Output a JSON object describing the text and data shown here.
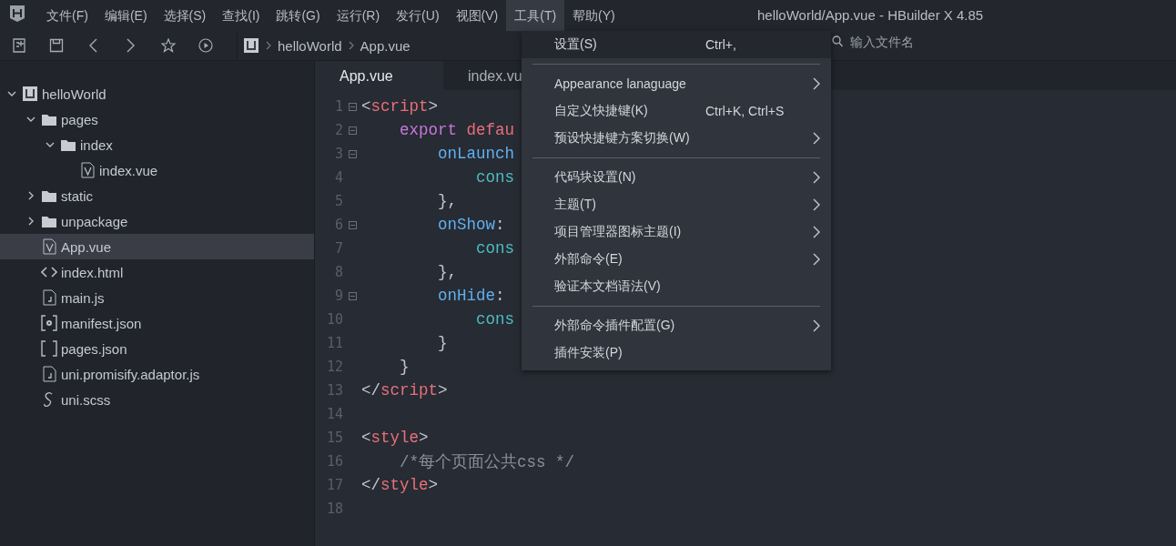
{
  "window": {
    "title": "helloWorld/App.vue - HBuilder X 4.85"
  },
  "menu_bar": [
    {
      "label": "文件(F)",
      "selected": false
    },
    {
      "label": "编辑(E)",
      "selected": false
    },
    {
      "label": "选择(S)",
      "selected": false
    },
    {
      "label": "查找(I)",
      "selected": false
    },
    {
      "label": "跳转(G)",
      "selected": false
    },
    {
      "label": "运行(R)",
      "selected": false
    },
    {
      "label": "发行(U)",
      "selected": false
    },
    {
      "label": "视图(V)",
      "selected": false
    },
    {
      "label": "工具(T)",
      "selected": true
    },
    {
      "label": "帮助(Y)",
      "selected": false
    }
  ],
  "breadcrumb": [
    "helloWorld",
    "App.vue"
  ],
  "search": {
    "placeholder": "输入文件名"
  },
  "project_tree": [
    {
      "label": "helloWorld",
      "kind": "project",
      "expanded": true,
      "selected": false,
      "children": [
        {
          "label": "pages",
          "kind": "folder",
          "expanded": true,
          "selected": false,
          "children": [
            {
              "label": "index",
              "kind": "folder",
              "expanded": true,
              "selected": false,
              "children": [
                {
                  "label": "index.vue",
                  "kind": "vue",
                  "selected": false
                }
              ]
            }
          ]
        },
        {
          "label": "static",
          "kind": "folder",
          "expanded": false,
          "selected": false
        },
        {
          "label": "unpackage",
          "kind": "folder",
          "expanded": false,
          "selected": false
        },
        {
          "label": "App.vue",
          "kind": "vue",
          "selected": true
        },
        {
          "label": "index.html",
          "kind": "html",
          "selected": false
        },
        {
          "label": "main.js",
          "kind": "js",
          "selected": false
        },
        {
          "label": "manifest.json",
          "kind": "settings",
          "selected": false
        },
        {
          "label": "pages.json",
          "kind": "brackets",
          "selected": false
        },
        {
          "label": "uni.promisify.adaptor.js",
          "kind": "js",
          "selected": false
        },
        {
          "label": "uni.scss",
          "kind": "scss",
          "selected": false
        }
      ]
    }
  ],
  "editor_tabs": [
    {
      "label": "App.vue",
      "selected": true
    },
    {
      "label": "index.vu",
      "selected": false
    }
  ],
  "code_lines": [
    {
      "number": "1",
      "fold": true,
      "tokens": [
        {
          "kind": "punct",
          "text": "<"
        },
        {
          "kind": "tag",
          "text": "script"
        },
        {
          "kind": "punct",
          "text": ">"
        }
      ]
    },
    {
      "number": "2",
      "fold": true,
      "tokens": [
        {
          "kind": "keyword",
          "text": "    export "
        },
        {
          "kind": "tag",
          "text": "defau"
        }
      ]
    },
    {
      "number": "3",
      "fold": true,
      "tokens": [
        {
          "kind": "prop",
          "text": "        onLaunch"
        }
      ]
    },
    {
      "number": "4",
      "fold": false,
      "tokens": [
        {
          "kind": "call",
          "text": "            cons"
        }
      ]
    },
    {
      "number": "5",
      "fold": false,
      "tokens": [
        {
          "kind": "punct",
          "text": "        },"
        }
      ]
    },
    {
      "number": "6",
      "fold": true,
      "tokens": [
        {
          "kind": "prop",
          "text": "        onShow"
        },
        {
          "kind": "punct",
          "text": ":"
        }
      ]
    },
    {
      "number": "7",
      "fold": false,
      "tokens": [
        {
          "kind": "call",
          "text": "            cons"
        }
      ]
    },
    {
      "number": "8",
      "fold": false,
      "tokens": [
        {
          "kind": "punct",
          "text": "        },"
        }
      ]
    },
    {
      "number": "9",
      "fold": true,
      "tokens": [
        {
          "kind": "prop",
          "text": "        onHide"
        },
        {
          "kind": "punct",
          "text": ":"
        }
      ]
    },
    {
      "number": "10",
      "fold": false,
      "tokens": [
        {
          "kind": "call",
          "text": "            cons"
        }
      ]
    },
    {
      "number": "11",
      "fold": false,
      "tokens": [
        {
          "kind": "punct",
          "text": "        }"
        }
      ]
    },
    {
      "number": "12",
      "fold": false,
      "tokens": [
        {
          "kind": "punct",
          "text": "    }"
        }
      ]
    },
    {
      "number": "13",
      "fold": false,
      "tokens": [
        {
          "kind": "punct",
          "text": "</"
        },
        {
          "kind": "tag",
          "text": "script"
        },
        {
          "kind": "punct",
          "text": ">"
        }
      ]
    },
    {
      "number": "14",
      "fold": false
    },
    {
      "number": "15",
      "fold": false,
      "tokens": [
        {
          "kind": "punct",
          "text": "<"
        },
        {
          "kind": "tag",
          "text": "style"
        },
        {
          "kind": "punct",
          "text": ">"
        }
      ]
    },
    {
      "number": "16",
      "fold": false,
      "tokens": [
        {
          "kind": "comment",
          "text": "    /*每个页面公共css */"
        }
      ]
    },
    {
      "number": "17",
      "fold": false,
      "tokens": [
        {
          "kind": "punct",
          "text": "</"
        },
        {
          "kind": "tag",
          "text": "style"
        },
        {
          "kind": "punct",
          "text": ">"
        }
      ]
    },
    {
      "number": "18",
      "fold": false
    }
  ],
  "tools_menu": [
    {
      "kind": "item",
      "label": "设置(S)",
      "shortcut": "Ctrl+,",
      "submenu": false,
      "selected": true
    },
    {
      "kind": "separator"
    },
    {
      "kind": "item",
      "label": "Appearance lanaguage",
      "submenu": true,
      "selected": false
    },
    {
      "kind": "item",
      "label": "自定义快捷键(K)",
      "shortcut": "Ctrl+K, Ctrl+S",
      "submenu": false,
      "selected": false
    },
    {
      "kind": "item",
      "label": "预设快捷键方案切换(W)",
      "submenu": true,
      "selected": false
    },
    {
      "kind": "separator"
    },
    {
      "kind": "item",
      "label": "代码块设置(N)",
      "submenu": true,
      "selected": false
    },
    {
      "kind": "item",
      "label": "主题(T)",
      "submenu": true,
      "selected": false
    },
    {
      "kind": "item",
      "label": "项目管理器图标主题(I)",
      "submenu": true,
      "selected": false
    },
    {
      "kind": "item",
      "label": "外部命令(E)",
      "submenu": true,
      "selected": false
    },
    {
      "kind": "item",
      "label": "验证本文档语法(V)",
      "submenu": false,
      "selected": false
    },
    {
      "kind": "separator"
    },
    {
      "kind": "item",
      "label": "外部命令插件配置(G)",
      "submenu": true,
      "selected": false
    },
    {
      "kind": "item",
      "label": "插件安装(P)",
      "submenu": false,
      "selected": false
    }
  ]
}
